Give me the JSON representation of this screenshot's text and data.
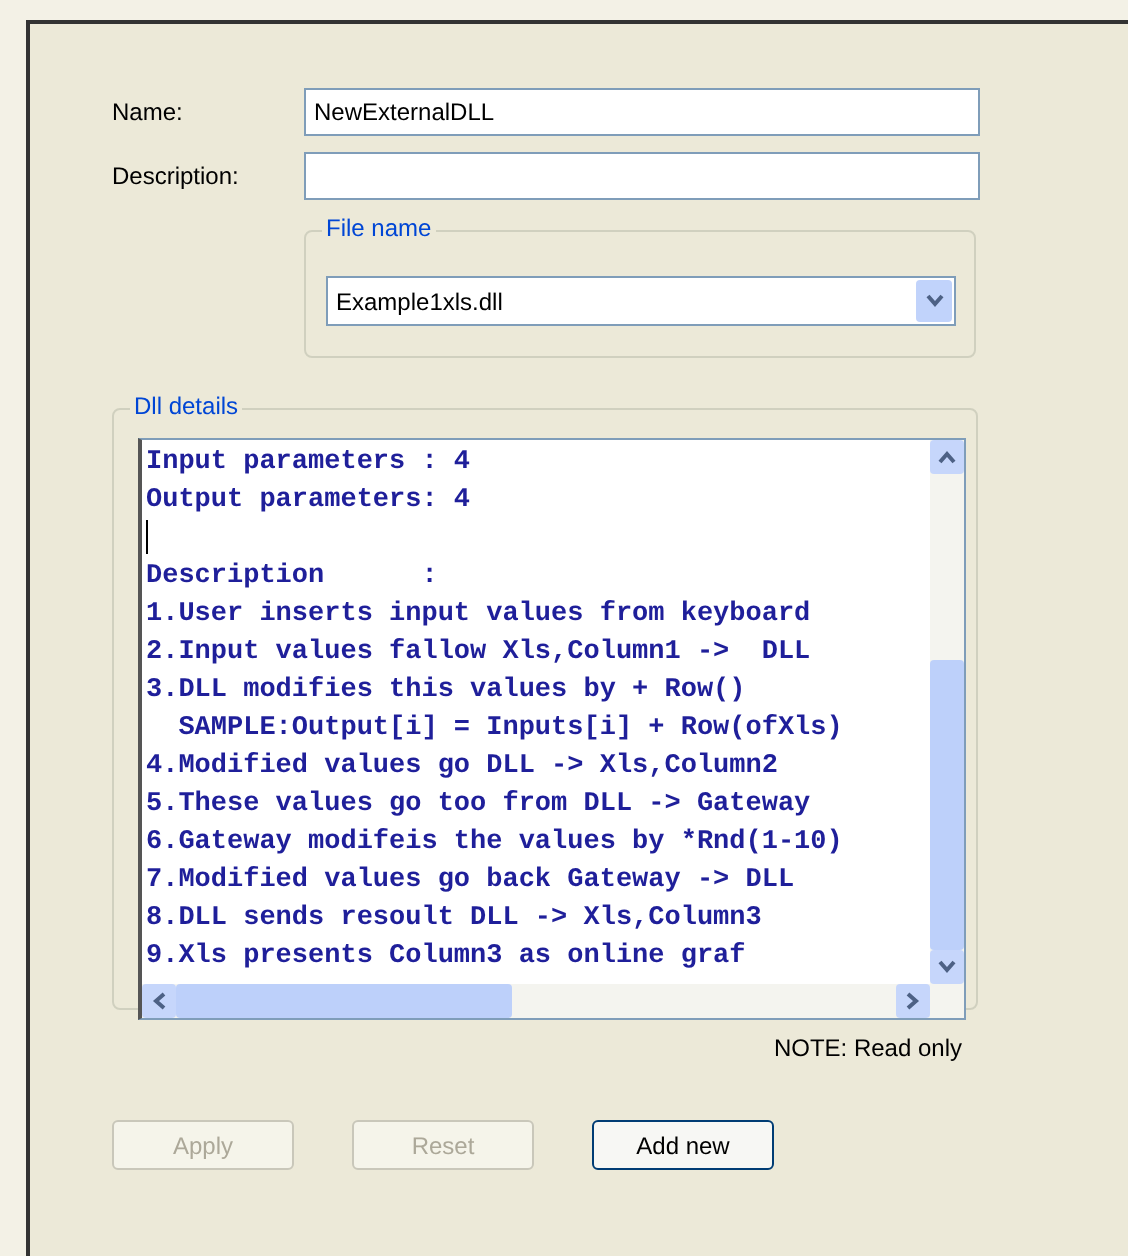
{
  "fields": [
    {
      "label": "Name:",
      "value": "NewExternalDLL"
    },
    {
      "label": "Description:"
    }
  ],
  "file_name": {
    "legend": "File name",
    "value": "Example1xls.dll"
  },
  "dll_details": {
    "legend": "Dll details",
    "lines": [
      {
        "text": "Input parameters : 4"
      },
      {
        "text": "Output parameters: 4"
      },
      {
        "caret": true
      },
      {
        "text": "Description      :"
      },
      {
        "text": "1.User inserts input values from keyboard"
      },
      {
        "text": "2.Input values fallow Xls,Column1 ->  DLL"
      },
      {
        "text": "3.DLL modifies this values by + Row()"
      },
      {
        "text": "  SAMPLE:Output[i] = Inputs[i] + Row(ofXls)"
      },
      {
        "text": "4.Modified values go DLL -> Xls,Column2"
      },
      {
        "text": "5.These values go too from DLL -> Gateway"
      },
      {
        "text": "6.Gateway modifeis the values by *Rnd(1-10)"
      },
      {
        "text": "7.Modified values go back Gateway -> DLL"
      },
      {
        "text": "8.DLL sends resoult DLL -> Xls,Column3"
      },
      {
        "text": "9.Xls presents Column3 as online graf"
      }
    ],
    "note": "NOTE: Read only"
  },
  "buttons": [
    {
      "label": "Apply",
      "disabled": true
    },
    {
      "label": "Reset",
      "disabled": true
    },
    {
      "label": "Add new",
      "disabled": false
    }
  ]
}
